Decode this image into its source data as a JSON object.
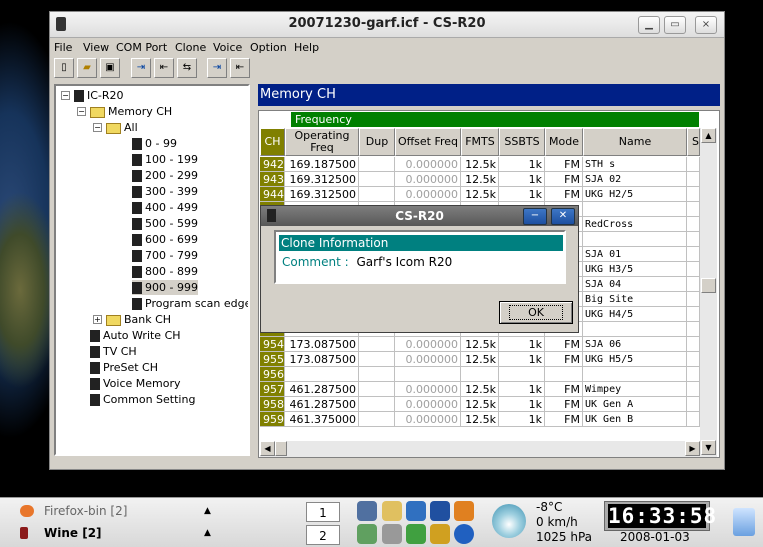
{
  "window": {
    "title": "20071230-garf.icf - CS-R20",
    "min_icon": "minimize-icon",
    "max_icon": "maximize-icon",
    "close_label": "×"
  },
  "menu": [
    "File",
    "View",
    "COM Port",
    "Clone",
    "Voice",
    "Option",
    "Help"
  ],
  "tree": {
    "root": "IC-R20",
    "memory": "Memory CH",
    "all": "All",
    "ranges": [
      "0 - 99",
      "100 - 199",
      "200 - 299",
      "300 - 399",
      "400 - 499",
      "500 - 599",
      "600 - 699",
      "700 - 799",
      "800 - 899",
      "900 - 999"
    ],
    "program_scan": "Program scan edge",
    "bank": "Bank CH",
    "others": [
      "Auto Write CH",
      "TV CH",
      "PreSet CH",
      "Voice Memory",
      "Common Setting"
    ]
  },
  "pane": {
    "title": "Memory CH",
    "group_header": "Frequency",
    "columns": {
      "ch": "CH",
      "freq": "Operating Freq",
      "dup": "Dup",
      "offset": "Offset Freq",
      "fmts": "FMTS",
      "ssbts": "SSBTS",
      "mode": "Mode",
      "name": "Name",
      "s": "S"
    },
    "rows": [
      {
        "ch": "942",
        "freq": "169.187500",
        "offset": "0.000000",
        "fmts": "12.5k",
        "ssbts": "1k",
        "mode": "FM",
        "name": "STH s"
      },
      {
        "ch": "943",
        "freq": "169.312500",
        "offset": "0.000000",
        "fmts": "12.5k",
        "ssbts": "1k",
        "mode": "FM",
        "name": "SJA 02"
      },
      {
        "ch": "944",
        "freq": "169.312500",
        "offset": "0.000000",
        "fmts": "12.5k",
        "ssbts": "1k",
        "mode": "FM",
        "name": "UKG H2/5"
      },
      {
        "ch": "",
        "freq": "",
        "offset": "",
        "fmts": "",
        "ssbts": "",
        "mode": "",
        "name": ""
      },
      {
        "ch": "",
        "freq": "",
        "offset": "",
        "fmts": "",
        "ssbts": "",
        "mode": "",
        "name": "RedCross"
      },
      {
        "ch": "",
        "freq": "",
        "offset": "",
        "fmts": "",
        "ssbts": "",
        "mode": "",
        "name": ""
      },
      {
        "ch": "",
        "freq": "",
        "offset": "",
        "fmts": "",
        "ssbts": "",
        "mode": "",
        "name": "SJA 01"
      },
      {
        "ch": "",
        "freq": "",
        "offset": "",
        "fmts": "",
        "ssbts": "",
        "mode": "",
        "name": "UKG H3/5"
      },
      {
        "ch": "",
        "freq": "",
        "offset": "",
        "fmts": "",
        "ssbts": "",
        "mode": "",
        "name": "SJA 04"
      },
      {
        "ch": "",
        "freq": "",
        "offset": "",
        "fmts": "",
        "ssbts": "",
        "mode": "",
        "name": "Big Site"
      },
      {
        "ch": "",
        "freq": "",
        "offset": "",
        "fmts": "",
        "ssbts": "",
        "mode": "",
        "name": "UKG H4/5"
      },
      {
        "ch": "",
        "freq": "",
        "offset": "",
        "fmts": "",
        "ssbts": "",
        "mode": "",
        "name": ""
      },
      {
        "ch": "954",
        "freq": "173.087500",
        "offset": "0.000000",
        "fmts": "12.5k",
        "ssbts": "1k",
        "mode": "FM",
        "name": "SJA 06"
      },
      {
        "ch": "955",
        "freq": "173.087500",
        "offset": "0.000000",
        "fmts": "12.5k",
        "ssbts": "1k",
        "mode": "FM",
        "name": "UKG H5/5"
      },
      {
        "ch": "956",
        "freq": "",
        "offset": "",
        "fmts": "",
        "ssbts": "",
        "mode": "",
        "name": ""
      },
      {
        "ch": "957",
        "freq": "461.287500",
        "offset": "0.000000",
        "fmts": "12.5k",
        "ssbts": "1k",
        "mode": "FM",
        "name": "Wimpey"
      },
      {
        "ch": "958",
        "freq": "461.287500",
        "offset": "0.000000",
        "fmts": "12.5k",
        "ssbts": "1k",
        "mode": "FM",
        "name": "UK Gen A"
      },
      {
        "ch": "959",
        "freq": "461.375000",
        "offset": "0.000000",
        "fmts": "12.5k",
        "ssbts": "1k",
        "mode": "FM",
        "name": "UK Gen B"
      }
    ]
  },
  "dialog": {
    "title": "CS-R20",
    "header": "Clone Information",
    "comment_label": "Comment :",
    "comment_value": "Garf's Icom R20",
    "ok": "OK"
  },
  "taskbar": {
    "tasks": [
      {
        "label": "Firefox-bin [2]",
        "icon": "firefox-icon",
        "color": "#e8762b"
      },
      {
        "label": "Wine [2]",
        "icon": "wine-icon",
        "color": "#8b1a1a"
      }
    ],
    "pager": [
      "1",
      "2"
    ],
    "weather": {
      "temp": "-8°C",
      "wind": "0 km/h",
      "pressure": "1025 hPa"
    },
    "clock": "16:33:58",
    "date": "2008-01-03"
  }
}
